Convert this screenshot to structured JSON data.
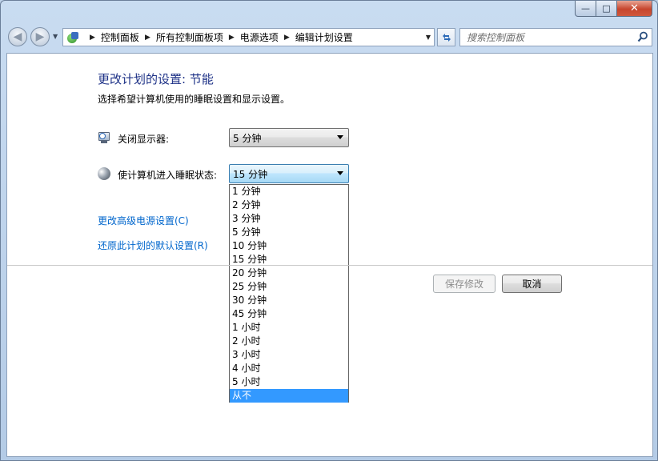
{
  "window": {
    "caption": {
      "minimize": "—",
      "maximize": "□",
      "close": "✕"
    }
  },
  "nav": {
    "breadcrumbs": [
      "控制面板",
      "所有控制面板项",
      "电源选项",
      "编辑计划设置"
    ],
    "search_placeholder": "搜索控制面板"
  },
  "page": {
    "title": "更改计划的设置: 节能",
    "subtitle": "选择希望计算机使用的睡眠设置和显示设置。"
  },
  "display_setting": {
    "label": "关闭显示器:",
    "value": "5 分钟"
  },
  "sleep_setting": {
    "label": "使计算机进入睡眠状态:",
    "value": "15 分钟",
    "options": [
      "1 分钟",
      "2 分钟",
      "3 分钟",
      "5 分钟",
      "10 分钟",
      "15 分钟",
      "20 分钟",
      "25 分钟",
      "30 分钟",
      "45 分钟",
      "1 小时",
      "2 小时",
      "3 小时",
      "4 小时",
      "5 小时",
      "从不"
    ],
    "highlighted_option": "从不"
  },
  "links": {
    "advanced": "更改高级电源设置(C)",
    "restore": "还原此计划的默认设置(R)"
  },
  "buttons": {
    "save": "保存修改",
    "cancel": "取消"
  },
  "colors": {
    "title": "#1e3287",
    "link": "#0066cc",
    "highlight": "#3399ff"
  }
}
